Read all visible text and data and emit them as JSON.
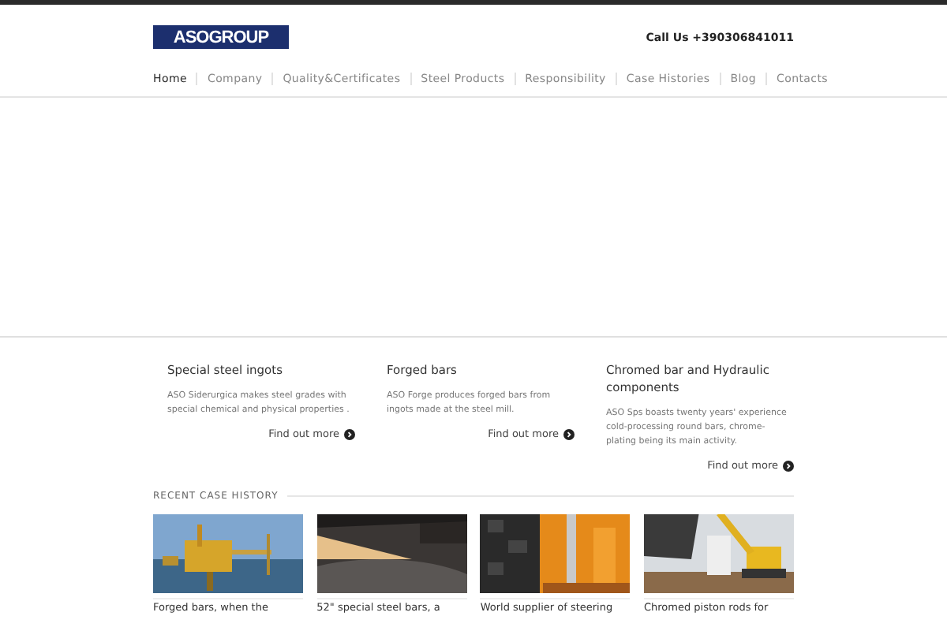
{
  "header": {
    "logo": "ASOGROUP",
    "phone": "Call Us +390306841011"
  },
  "nav": [
    {
      "label": "Home",
      "selected": true
    },
    {
      "label": "Company",
      "selected": false
    },
    {
      "label": "Quality&Certificates",
      "selected": false
    },
    {
      "label": "Steel Products",
      "selected": false
    },
    {
      "label": "Responsibility",
      "selected": false
    },
    {
      "label": "Case Histories",
      "selected": false
    },
    {
      "label": "Blog",
      "selected": false
    },
    {
      "label": "Contacts",
      "selected": false
    }
  ],
  "features": [
    {
      "title": "Special steel ingots",
      "text": "ASO Siderurgica makes steel grades with special chemical and physical properties .",
      "link": "Find out more"
    },
    {
      "title": "Forged bars",
      "text": "ASO Forge produces forged bars from ingots made at the steel mill.",
      "link": "Find out more"
    },
    {
      "title": "Chromed bar and Hydraulic components",
      "text": "ASO Sps boasts twenty years' experience cold-processing round bars, chrome-plating being its main activity.",
      "link": "Find out more"
    }
  ],
  "recent": {
    "heading": "RECENT CASE HISTORY",
    "items": [
      {
        "title": "Forged bars, when the",
        "kind": "picture"
      },
      {
        "title": "52\" special steel bars, a",
        "kind": "picture"
      },
      {
        "title": "World supplier of steering",
        "kind": "picture"
      },
      {
        "title": "Chromed piston rods for",
        "kind": "picture"
      }
    ]
  }
}
